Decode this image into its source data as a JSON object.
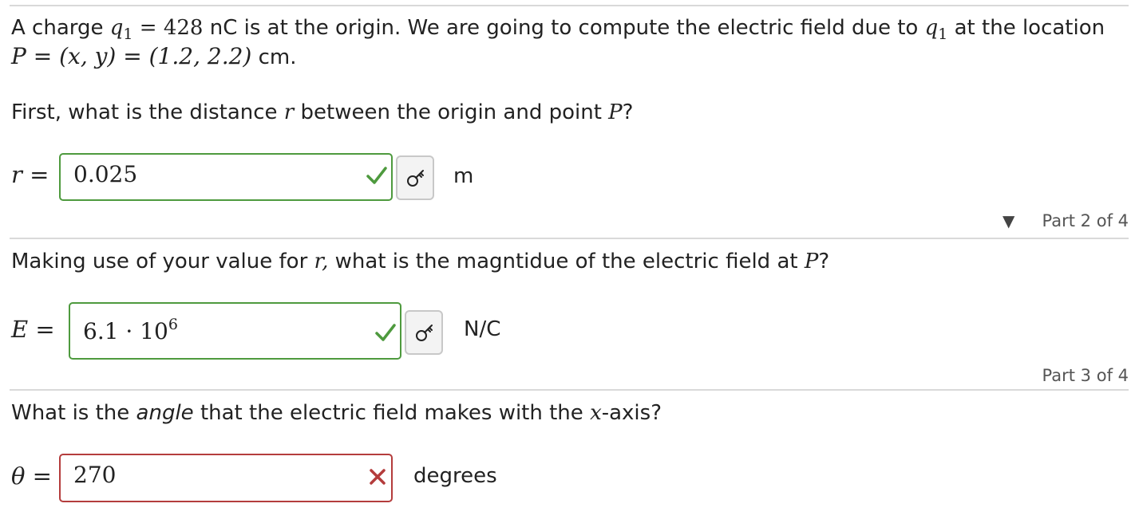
{
  "intro": {
    "prefix": "A charge",
    "q_symbol": "q",
    "q_sub": "1",
    "equals_value": "= 428",
    "mid": "nC is at the origin. We are going to compute the electric field due to",
    "suffix": "at the location",
    "point_math": "P = (x, y) = (1.2, 2.2)",
    "point_unit": "cm."
  },
  "part1": {
    "question_pre": "First, what is the distance",
    "question_var": "r",
    "question_post": "between the origin and point",
    "question_point": "P",
    "question_end": "?",
    "label": "r =",
    "value": "0.025",
    "status": "correct",
    "unit": "m"
  },
  "part2": {
    "part_label": "Part 2 of 4",
    "question_pre": "Making use of your value for",
    "question_var": "r,",
    "question_post": "what is the magntidue of the electric field at",
    "question_point": "P",
    "question_end": "?",
    "label": "E =",
    "value_base": "6.1 · 10",
    "value_exp": "6",
    "status": "correct",
    "unit": "N/C"
  },
  "part3": {
    "part_label": "Part 3 of 4",
    "question_pre": "What is the",
    "question_emph": "angle",
    "question_post": "that the electric field makes with the",
    "question_var": "x",
    "question_end": "-axis?",
    "label": "θ =",
    "value": "270",
    "status": "wrong",
    "unit": "degrees"
  },
  "colors": {
    "correct": "#4e9a3e",
    "wrong": "#b43c3c",
    "divider": "#d9d9d9"
  },
  "icons": [
    "checkmark-icon",
    "key-icon",
    "cross-icon",
    "collapse-triangle-icon"
  ]
}
